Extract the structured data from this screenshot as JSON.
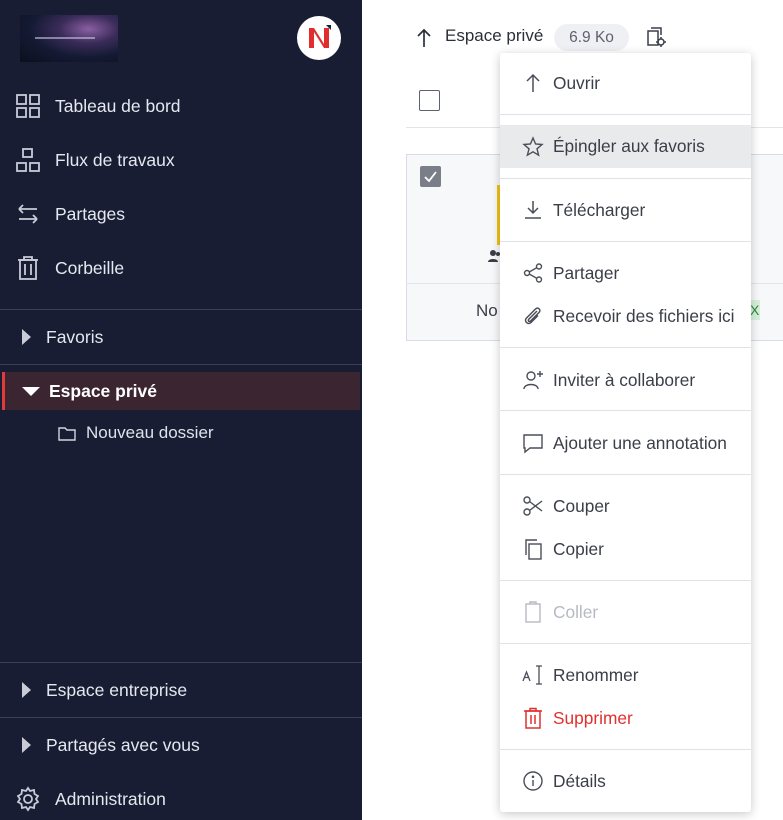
{
  "sidebar": {
    "nav": [
      {
        "label": "Tableau de bord",
        "icon": "grid-icon"
      },
      {
        "label": "Flux de travaux",
        "icon": "workflow-icon"
      },
      {
        "label": "Partages",
        "icon": "swap-icon"
      },
      {
        "label": "Corbeille",
        "icon": "trash-icon"
      }
    ],
    "sections": {
      "favoris": "Favoris",
      "espace_prive": "Espace privé",
      "espace_entreprise": "Espace entreprise",
      "partages_avec_vous": "Partagés avec vous"
    },
    "subfolder": "Nouveau dossier",
    "admin": "Administration"
  },
  "header": {
    "breadcrumb": "Espace privé",
    "size": "6.9 Ko"
  },
  "card": {
    "name_fragment": "No",
    "tag_fragment": "X"
  },
  "context_menu": {
    "items": [
      {
        "label": "Ouvrir",
        "icon": "arrow-up-icon"
      },
      {
        "label": "Épingler aux favoris",
        "icon": "star-icon"
      },
      {
        "label": "Télécharger",
        "icon": "download-icon"
      },
      {
        "label": "Partager",
        "icon": "share-icon"
      },
      {
        "label": "Recevoir des fichiers ici",
        "icon": "paperclip-icon"
      },
      {
        "label": "Inviter à collaborer",
        "icon": "add-user-icon"
      },
      {
        "label": "Ajouter une annotation",
        "icon": "comment-icon"
      },
      {
        "label": "Couper",
        "icon": "scissors-icon"
      },
      {
        "label": "Copier",
        "icon": "copy-icon"
      },
      {
        "label": "Coller",
        "icon": "clipboard-icon"
      },
      {
        "label": "Renommer",
        "icon": "rename-icon"
      },
      {
        "label": "Supprimer",
        "icon": "trash-icon"
      },
      {
        "label": "Détails",
        "icon": "info-icon"
      }
    ],
    "highlighted": "Épingler aux favoris",
    "disabled": [
      "Coller"
    ],
    "danger_color": "#e0312e"
  },
  "colors": {
    "sidebar_bg": "#181d33",
    "active_bg": "#3b2530",
    "accent": "#e03a3a"
  }
}
